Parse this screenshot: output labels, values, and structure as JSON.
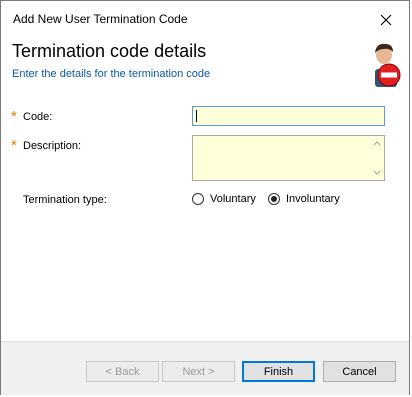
{
  "window": {
    "title": "Add New User Termination Code"
  },
  "header": {
    "title": "Termination code details",
    "subtitle": "Enter the details for the termination code",
    "icon": "user-remove-icon"
  },
  "form": {
    "code": {
      "label": "Code:",
      "required_marker": "*",
      "value": ""
    },
    "description": {
      "label": "Description:",
      "required_marker": "*",
      "value": ""
    },
    "termination_type": {
      "label": "Termination type:",
      "options": [
        "Voluntary",
        "Involuntary"
      ],
      "selected": "Involuntary"
    }
  },
  "buttons": {
    "back": "< Back",
    "next": "Next >",
    "finish": "Finish",
    "cancel": "Cancel"
  },
  "colors": {
    "accent": "#0078d7",
    "required": "#e07a00",
    "input_bg": "#ffffd9",
    "subtitle": "#0a5a9c"
  }
}
